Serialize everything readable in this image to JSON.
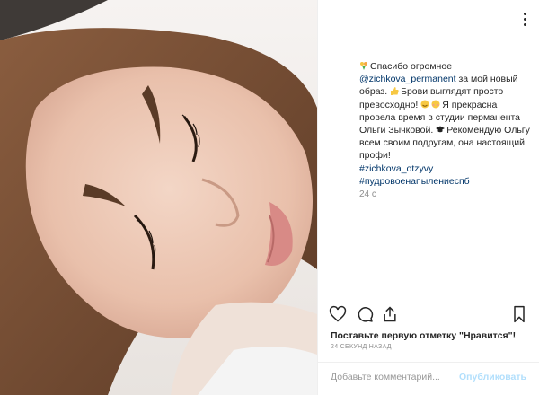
{
  "post": {
    "caption": {
      "part1": "Спасибо огромное",
      "mention": "@zichkova_permanent",
      "part2": " за мой новый образ.",
      "part3": "Брови выглядят просто превосходно!",
      "part4": "Я прекрасна провела время в студии перманента Ольги Зычковой.",
      "part5": "Рекомендую Ольгу всем своим подругам, она настоящий профи!",
      "tag1": "#zichkova_otzyvy",
      "tag2": "#пудровоенапылениеспб"
    },
    "caption_age": "24 с",
    "likes_text": "Поставьте первую отметку \"Нравится\"!",
    "timestamp": "24 СЕКУНД НАЗАД",
    "comment_placeholder": "Добавьте комментарий...",
    "publish_label": "Опубликовать"
  },
  "icons": {
    "heart": "heart-icon",
    "comment": "comment-icon",
    "share": "share-icon",
    "bookmark": "bookmark-icon",
    "more": "more-options-icon"
  },
  "colors": {
    "link": "#003569",
    "muted": "#8e8e8e",
    "publish_disabled": "#b2dffc"
  }
}
